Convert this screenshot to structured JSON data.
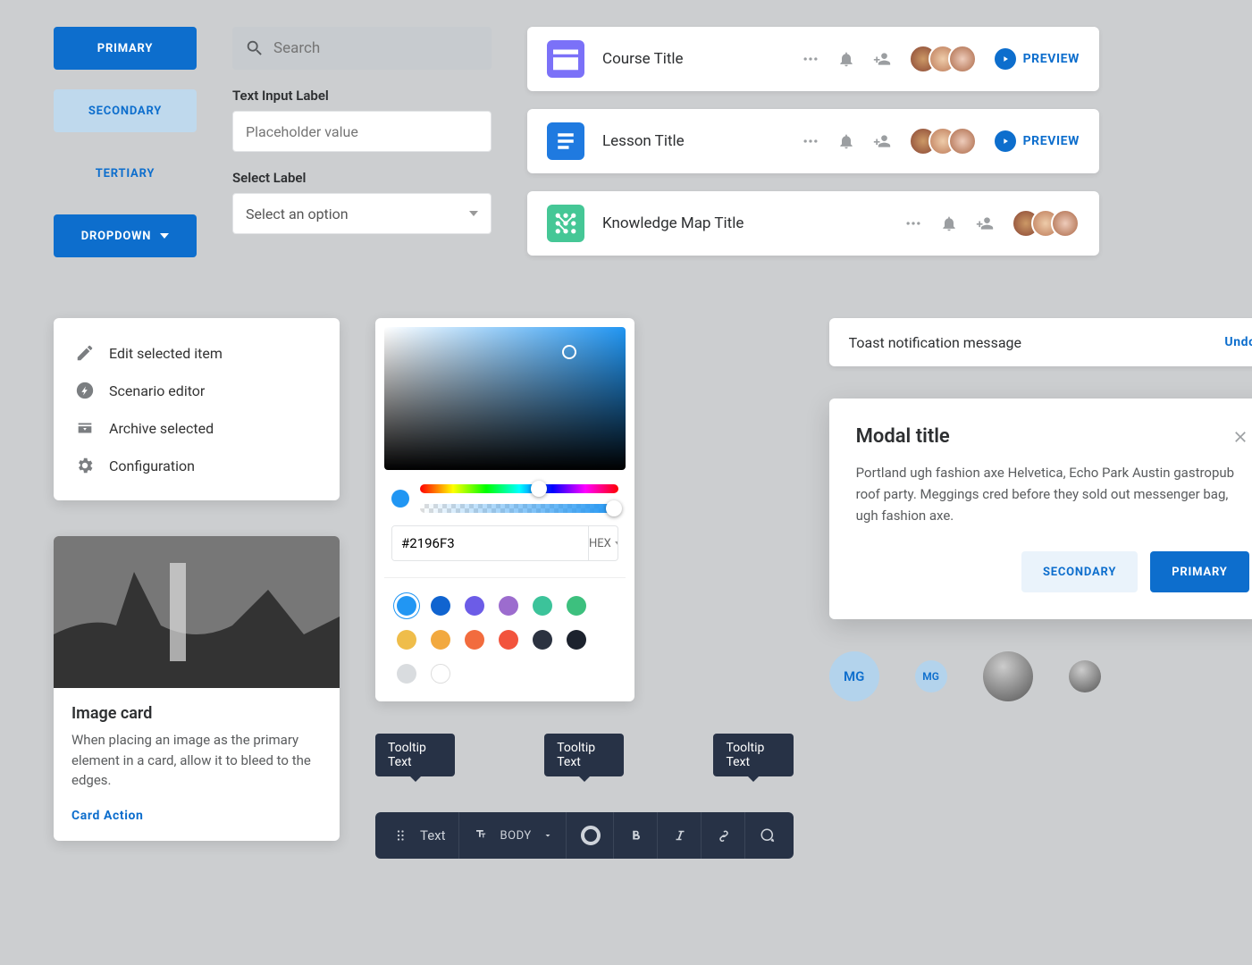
{
  "buttons": {
    "primary": "Primary",
    "secondary": "Secondary",
    "tertiary": "Tertiary",
    "dropdown": "Dropdown"
  },
  "inputs": {
    "search_placeholder": "Search",
    "text_label": "Text Input Label",
    "text_placeholder": "Placeholder value",
    "select_label": "Select Label",
    "select_placeholder": "Select an option"
  },
  "list_items": [
    {
      "title": "Course Title",
      "icon_color": "#7b71f8",
      "has_preview": true
    },
    {
      "title": "Lesson Title",
      "icon_color": "#1f7ae0",
      "has_preview": true
    },
    {
      "title": "Knowledge Map Title",
      "icon_color": "#45c796",
      "has_preview": false
    }
  ],
  "preview_label": "Preview",
  "menu": [
    "Edit selected item",
    "Scenario editor",
    "Archive selected",
    "Configuration"
  ],
  "color_picker": {
    "hex": "#2196F3",
    "format": "HEX",
    "swatches": [
      "#2196F3",
      "#1064d0",
      "#6c5ce7",
      "#9c6cce",
      "#3cc39a",
      "#3dc07e",
      "#efbd4a",
      "#f2a93f",
      "#f26c3e",
      "#f2543d",
      "#2b3240",
      "#1c222d",
      "#d9dcdf",
      "#ffffff"
    ]
  },
  "toast": {
    "message": "Toast notification message",
    "action": "Undo"
  },
  "modal": {
    "title": "Modal title",
    "body": "Portland ugh fashion axe Helvetica, Echo Park Austin gastropub roof party. Meggings cred before they sold out messenger bag, ugh fashion axe.",
    "secondary": "Secondary",
    "primary": "Primary"
  },
  "tooltips": [
    "Tooltip Text",
    "Tooltip Text",
    "Tooltip Text"
  ],
  "editor_bar": {
    "text": "Text",
    "style": "Body"
  },
  "image_card": {
    "title": "Image card",
    "body": "When placing an image as the primary element in a card, allow it to bleed to the edges.",
    "action": "Card Action"
  },
  "avatar_initials": "MG"
}
